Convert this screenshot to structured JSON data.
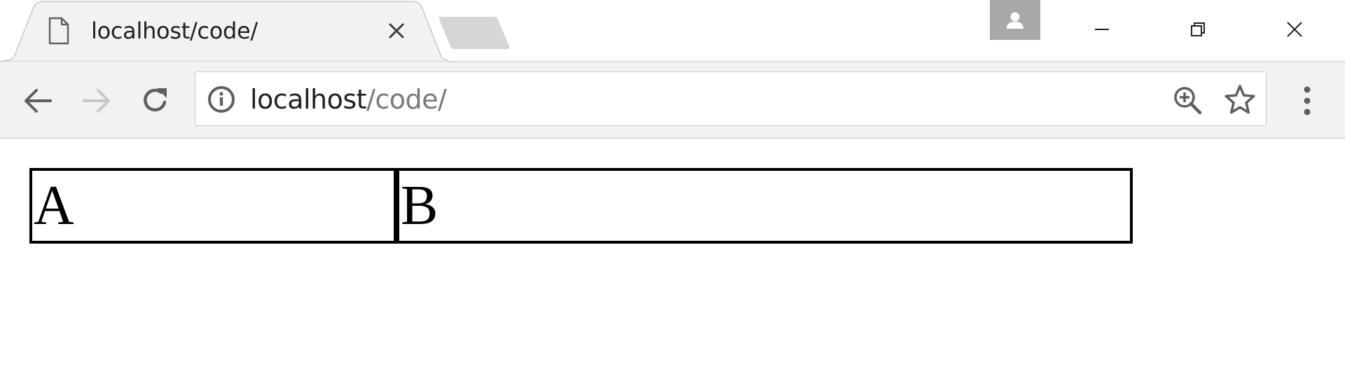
{
  "window": {
    "tab": {
      "title": "localhost/code/",
      "favicon": "page-icon",
      "close_icon": "close-icon"
    },
    "new_tab_icon": "new-tab-icon",
    "profile_icon": "profile-icon",
    "controls": {
      "minimize_icon": "minimize-icon",
      "maximize_icon": "restore-icon",
      "close_icon": "close-icon"
    }
  },
  "toolbar": {
    "back_icon": "arrow-left-icon",
    "forward_icon": "arrow-right-icon",
    "forward_enabled": false,
    "reload_icon": "reload-icon",
    "omnibox": {
      "info_icon": "info-icon",
      "host": "localhost",
      "path": "/code/",
      "zoom_icon": "zoom-in-icon",
      "bookmark_icon": "star-icon"
    },
    "menu_icon": "more-vertical-icon"
  },
  "content": {
    "cells": [
      "A",
      "B"
    ]
  },
  "colors": {
    "toolbar_bg": "#f2f2f2",
    "tab_bg": "#f2f2f2",
    "profile_bg": "#a8a8a8",
    "icon": "#5f5f5f",
    "icon_disabled": "#c8c8c8",
    "url_path": "#7a7a7a"
  }
}
